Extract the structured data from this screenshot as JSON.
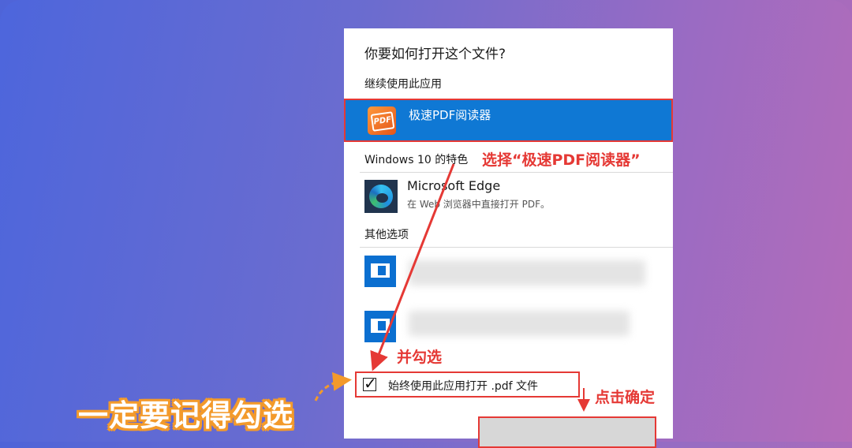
{
  "dialog": {
    "title": "你要如何打开这个文件?",
    "section_continue": "继续使用此应用",
    "selected_app": "极速PDF阅读器",
    "section_windows": "Windows 10 的特色",
    "edge": {
      "name": "Microsoft Edge",
      "description": "在 Web 浏览器中直接打开 PDF。"
    },
    "section_other": "其他选项",
    "checkbox": {
      "label": "始终使用此应用打开 .pdf 文件",
      "checked": true
    },
    "icons": {
      "selected_app": "pdf-reader-icon",
      "edge": "edge-icon",
      "other_app": "window-app-icon"
    }
  },
  "annotations": {
    "select_hint": "选择“极速PDF阅读器”",
    "check_hint": "并勾选",
    "ok_hint": "点击确定",
    "big_hint": "一定要记得勾选",
    "color": "#e53935",
    "big_color": "#f39a2b"
  }
}
